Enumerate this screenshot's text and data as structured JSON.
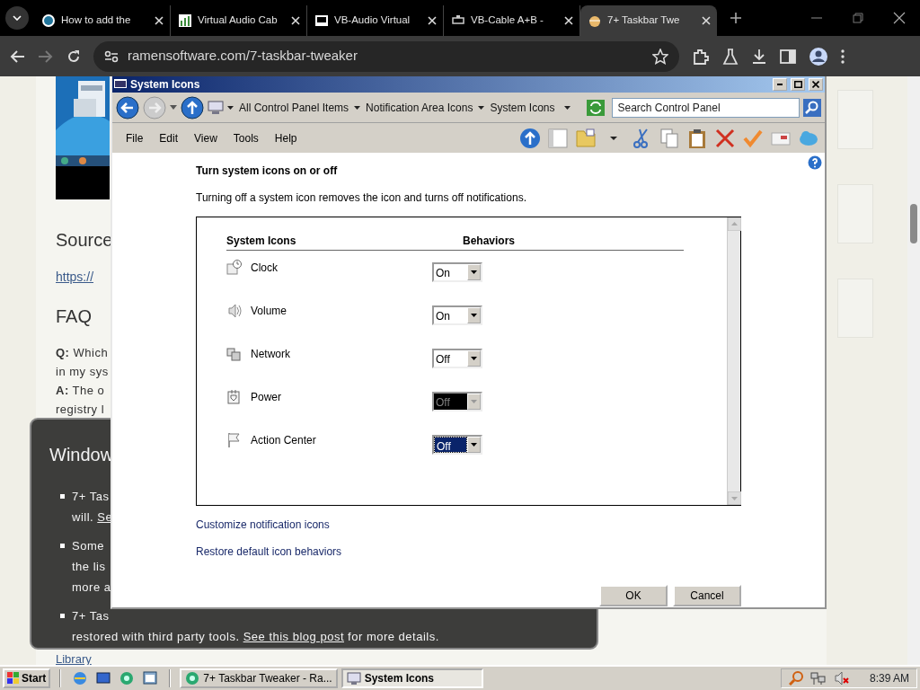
{
  "browser": {
    "tabs": [
      {
        "title": "How to add the",
        "selected": false
      },
      {
        "title": "Virtual Audio Cab",
        "selected": false
      },
      {
        "title": "VB-Audio Virtual",
        "selected": false
      },
      {
        "title": "VB-Cable A+B -",
        "selected": false
      },
      {
        "title": "7+ Taskbar Twe",
        "selected": true
      }
    ],
    "address": "ramensoftware.com/7-taskbar-tweaker"
  },
  "page": {
    "heading": "Source",
    "link": "https://",
    "faq_heading": "FAQ",
    "faq_lines": [
      "**Q:** Which",
      "in my sys",
      "**A:** The o",
      "registry l"
    ],
    "notice": {
      "title": "Window",
      "items": [
        {
          "lines": [
            [
              {
                "text": "7+ Tas",
                "link": false
              }
            ],
            [
              {
                "text": "will. ",
                "link": false
              },
              {
                "text": "Se",
                "link": true
              }
            ]
          ]
        },
        {
          "lines": [
            [
              {
                "text": "Some",
                "link": false
              }
            ],
            [
              {
                "text": "the lis",
                "link": false
              }
            ],
            [
              {
                "text": "more a",
                "link": false
              }
            ]
          ]
        },
        {
          "lines": [
            [
              {
                "text": "7+ Tas",
                "link": false
              }
            ],
            [
              {
                "text": "restored with third party tools. ",
                "link": false
              },
              {
                "text": "See this blog post",
                "link": true
              },
              {
                "text": " for more details.",
                "link": false
              }
            ]
          ]
        }
      ]
    },
    "footer_link": "Library"
  },
  "dialog": {
    "title": "System Icons",
    "breadcrumbs": [
      "All Control Panel Items",
      "Notification Area Icons",
      "System Icons"
    ],
    "search": {
      "placeholder": "Search Control Panel"
    },
    "menu": [
      "File",
      "Edit",
      "View",
      "Tools",
      "Help"
    ],
    "heading": "Turn system icons on or off",
    "description": "Turning off a system icon removes the icon and turns off notifications.",
    "columns": [
      "System Icons",
      "Behaviors"
    ],
    "rows": [
      {
        "name": "Clock",
        "value": "On",
        "disabled": false,
        "focused": false
      },
      {
        "name": "Volume",
        "value": "On",
        "disabled": false,
        "focused": false
      },
      {
        "name": "Network",
        "value": "Off",
        "disabled": false,
        "focused": false
      },
      {
        "name": "Power",
        "value": "Off",
        "disabled": true,
        "focused": false
      },
      {
        "name": "Action Center",
        "value": "Off",
        "disabled": false,
        "focused": true
      }
    ],
    "links": [
      "Customize notification icons",
      "Restore default icon behaviors"
    ],
    "buttons": [
      "OK",
      "Cancel"
    ]
  },
  "taskbar": {
    "start": "Start",
    "tasks": [
      {
        "title": "7+ Taskbar Tweaker - Ra...",
        "selected": false
      },
      {
        "title": "System Icons",
        "selected": true
      }
    ],
    "clock": "8:39 AM"
  }
}
